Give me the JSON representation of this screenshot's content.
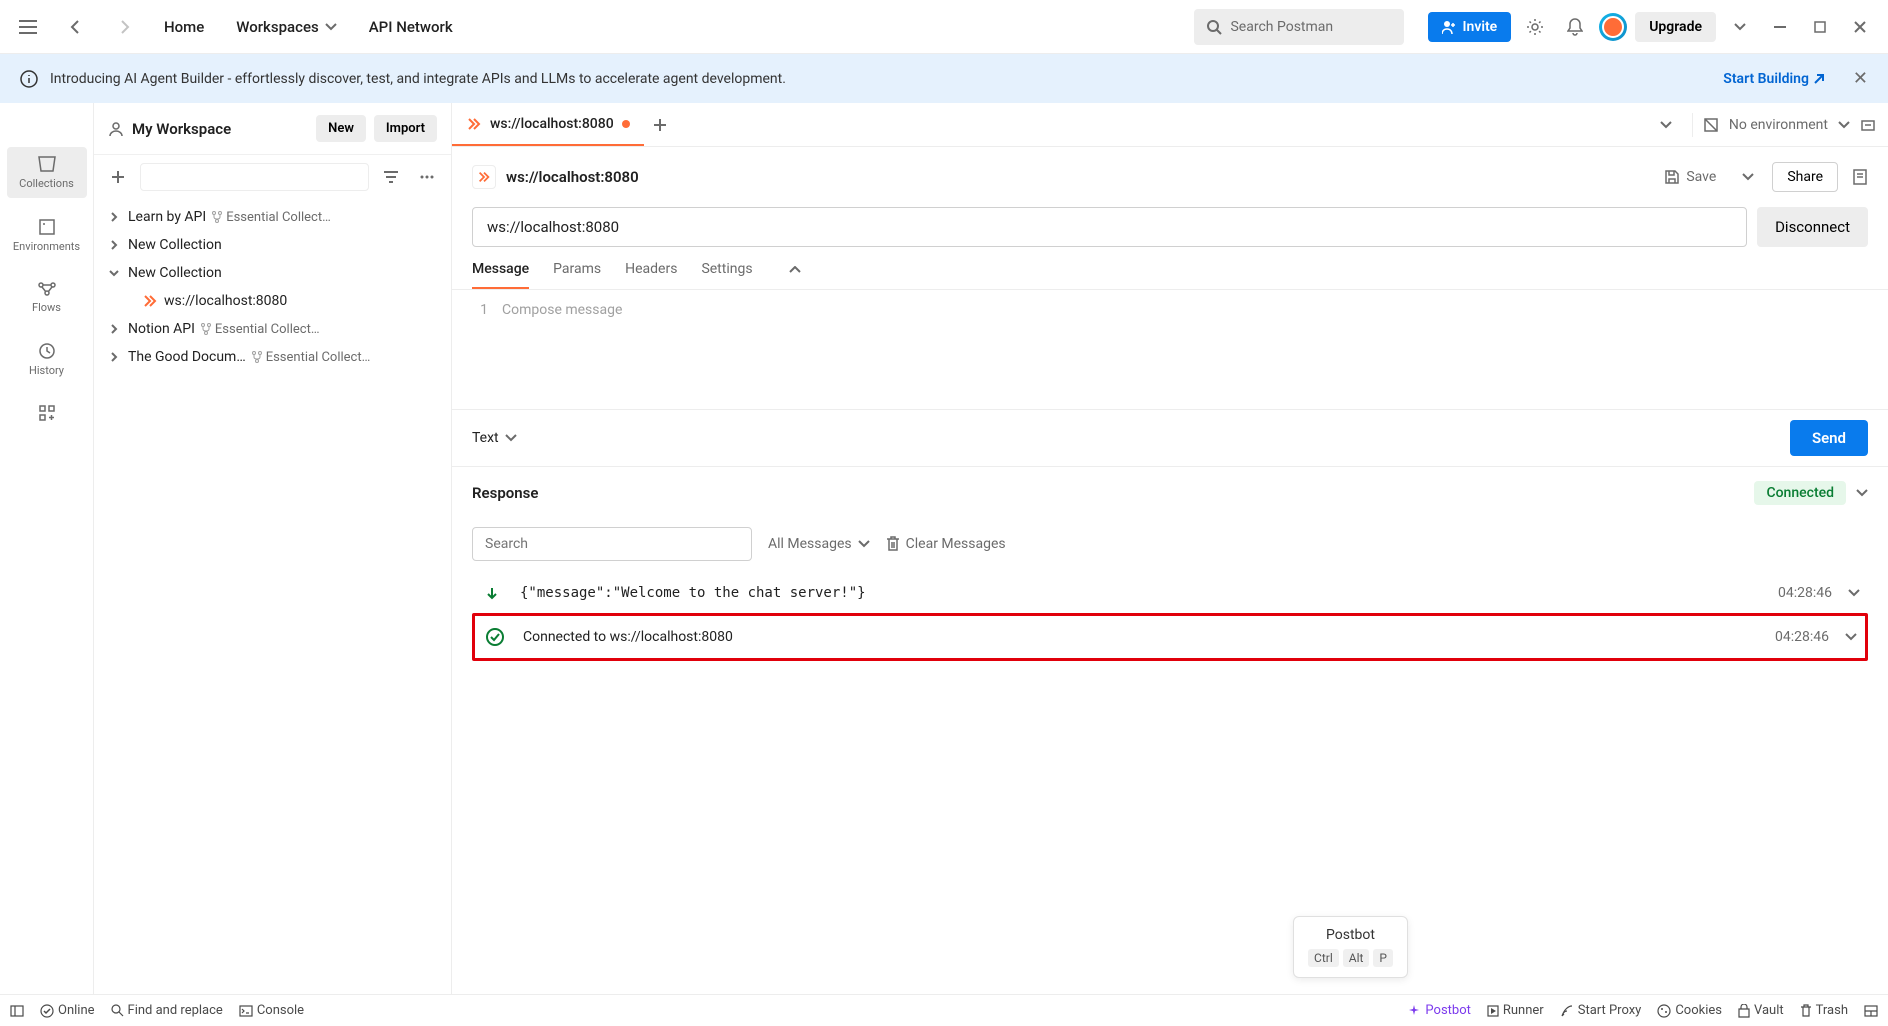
{
  "header": {
    "home": "Home",
    "workspaces": "Workspaces",
    "api_network": "API Network",
    "search_placeholder": "Search Postman",
    "invite": "Invite",
    "upgrade": "Upgrade"
  },
  "banner": {
    "text": "Introducing AI Agent Builder - effortlessly discover, test, and integrate APIs and LLMs to accelerate agent development.",
    "link": "Start Building"
  },
  "workspace": {
    "title": "My Workspace",
    "new": "New",
    "import": "Import"
  },
  "rail": {
    "collections": "Collections",
    "environments": "Environments",
    "flows": "Flows",
    "history": "History"
  },
  "tree": [
    {
      "label": "Learn by API",
      "sub": "Essential Collect…",
      "fork": true,
      "expanded": false,
      "depth": 0
    },
    {
      "label": "New Collection",
      "sub": "",
      "fork": false,
      "expanded": false,
      "depth": 0
    },
    {
      "label": "New Collection",
      "sub": "",
      "fork": false,
      "expanded": true,
      "depth": 0
    },
    {
      "label": "ws://localhost:8080",
      "sub": "",
      "fork": false,
      "expanded": false,
      "depth": 1,
      "ws": true
    },
    {
      "label": "Notion API",
      "sub": "Essential Collect…",
      "fork": true,
      "expanded": false,
      "depth": 0
    },
    {
      "label": "The Good Docum…",
      "sub": "Essential Collect…",
      "fork": true,
      "expanded": false,
      "depth": 0
    }
  ],
  "tab": {
    "title": "ws://localhost:8080",
    "modified": true
  },
  "env": {
    "label": "No environment"
  },
  "request": {
    "title": "ws://localhost:8080",
    "url": "ws://localhost:8080",
    "save": "Save",
    "share": "Share",
    "disconnect": "Disconnect"
  },
  "subtabs": {
    "message": "Message",
    "params": "Params",
    "headers": "Headers",
    "settings": "Settings"
  },
  "editor": {
    "line": "1",
    "placeholder": "Compose message"
  },
  "sendrow": {
    "format": "Text",
    "send": "Send"
  },
  "response": {
    "title": "Response",
    "status": "Connected",
    "search_placeholder": "Search",
    "filter": "All Messages",
    "clear": "Clear Messages",
    "messages": [
      {
        "dir": "incoming",
        "body": "{\"message\":\"Welcome to the chat server!\"}",
        "time": "04:28:46"
      },
      {
        "dir": "connected",
        "body": "Connected to ws://localhost:8080",
        "time": "04:28:46",
        "highlighted": true
      }
    ]
  },
  "postbot": {
    "title": "Postbot",
    "keys": [
      "Ctrl",
      "Alt",
      "P"
    ]
  },
  "status": {
    "online": "Online",
    "find": "Find and replace",
    "console": "Console",
    "postbot": "Postbot",
    "runner": "Runner",
    "proxy": "Start Proxy",
    "cookies": "Cookies",
    "vault": "Vault",
    "trash": "Trash"
  }
}
